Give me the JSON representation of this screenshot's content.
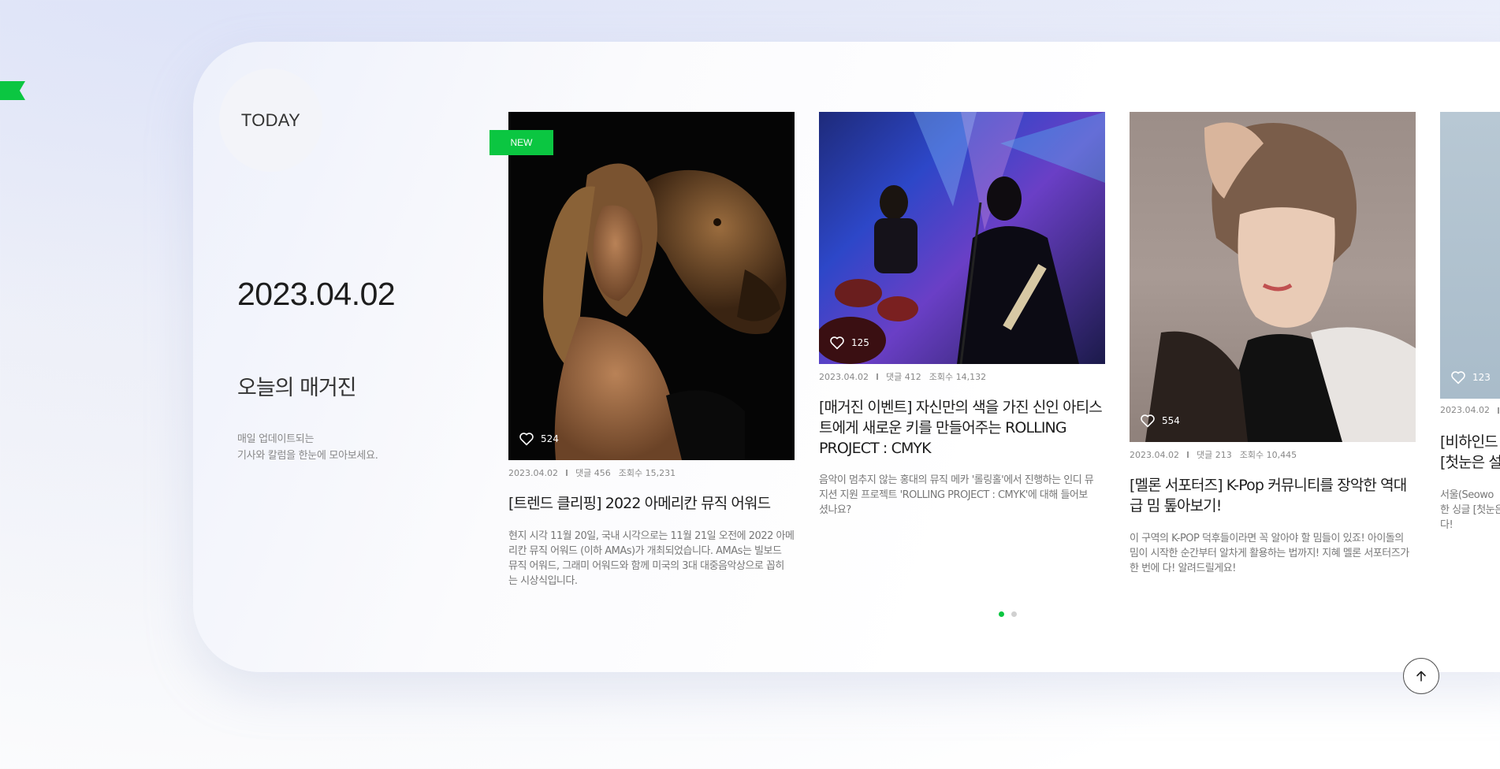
{
  "section": {
    "today_label": "TODAY",
    "date": "2023.04.02",
    "title": "오늘의 매거진",
    "desc_line1": "매일 업데이트되는",
    "desc_line2": "기사와 칼럼을 한눈에 모아보세요."
  },
  "new_badge": "NEW",
  "cards": [
    {
      "likes": "524",
      "date": "2023.04.02",
      "comments": "댓글 456",
      "views": "조회수 15,231",
      "title_lines": [
        "[트렌드 클리핑] 2022 아메리칸 뮤직 어워드"
      ],
      "desc_lines": [
        "현지 시각 11월 20일, 국내 시각으로는 11월 21일 오전에 2022 아메",
        "리칸 뮤직 어워드 (이하 AMAs)가 개최되었습니다. AMAs는 빌보드",
        "뮤직 어워드, 그래미 어워드와 함께 미국의 3대 대중음악상으로 꼽히",
        "는 시상식입니다."
      ]
    },
    {
      "likes": "125",
      "date": "2023.04.02",
      "comments": "댓글 412",
      "views": "조회수 14,132",
      "title_lines": [
        "[매거진 이벤트] 자신만의 색을 가진 신인 아티스",
        "트에게 새로운 키를 만들어주는 ROLLING",
        "PROJECT : CMYK"
      ],
      "desc_lines": [
        "음악이 멈추지 않는 홍대의 뮤직 메카 '롤링홀'에서 진행하는 인디 뮤",
        "지션 지원 프로젝트 'ROLLING PROJECT : CMYK'에 대해 들어보",
        "셨나요?"
      ]
    },
    {
      "likes": "554",
      "date": "2023.04.02",
      "comments": "댓글 213",
      "views": "조회수 10,445",
      "title_lines": [
        "[멜론 서포터즈] K-Pop 커뮤니티를 장악한 역대",
        "급 밈 톺아보기!"
      ],
      "desc_lines": [
        "이 구역의 K-POP 덕후들이라면 꼭 알아야 할 밈들이 있죠! 아이돌의",
        "밈이 시작한 순간부터 알차게 활용하는 법까지! 지혜 멜론 서포터즈가",
        "한 번에 다! 알려드릴게요!"
      ]
    },
    {
      "likes": "123",
      "date": "2023.04.02",
      "title_lines": [
        "[비하인드",
        "[첫눈은 설"
      ],
      "desc_lines": [
        "서울(Seowo",
        "한 싱글 [첫눈은",
        "다!"
      ]
    }
  ],
  "pagination": {
    "pages": 2,
    "current": 1
  },
  "colors": {
    "accent": "#0bc641",
    "text_dark": "#1d1d1d",
    "text_muted": "#888888"
  },
  "icons": {
    "like": "heart-outline-icon",
    "top": "arrow-up-icon"
  }
}
